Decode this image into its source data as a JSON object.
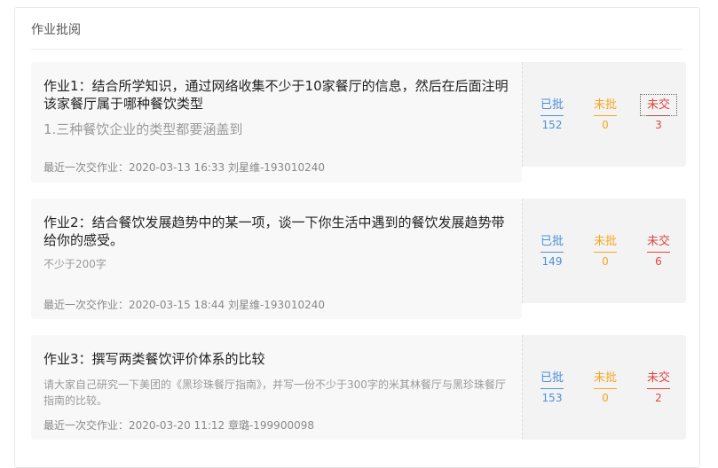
{
  "panel": {
    "title": "作业批阅"
  },
  "stat_labels": {
    "graded": "已批",
    "ungraded": "未批",
    "unsubmitted": "未交"
  },
  "colors": {
    "graded": "#4a90d9",
    "ungraded": "#f5a623",
    "unsubmitted": "#e0463f"
  },
  "assignments": [
    {
      "title": "作业1：结合所学知识，通过网络收集不少于10家餐厅的信息，然后在后面注明该家餐厅属于哪种餐饮类型",
      "description": "1.三种餐饮企业的类型都要涵盖到",
      "footer": "最近一次交作业：2020-03-13 16:33 刘星维-193010240",
      "graded": "152",
      "ungraded": "0",
      "unsubmitted": "3"
    },
    {
      "title": "作业2：结合餐饮发展趋势中的某一项，谈一下你生活中遇到的餐饮发展趋势带给你的感受。",
      "description": "不少于200字",
      "footer": "最近一次交作业：2020-03-15 18:44 刘星维-193010240",
      "graded": "149",
      "ungraded": "0",
      "unsubmitted": "6"
    },
    {
      "title": "作业3：撰写两类餐饮评价体系的比较",
      "description": "请大家自己研究一下美团的《黑珍珠餐厅指南》，并写一份不少于300字的米其林餐厅与黑珍珠餐厅指南的比较。",
      "footer": "最近一次交作业：2020-03-20 11:12 章璐-199900098",
      "graded": "153",
      "ungraded": "0",
      "unsubmitted": "2"
    }
  ]
}
